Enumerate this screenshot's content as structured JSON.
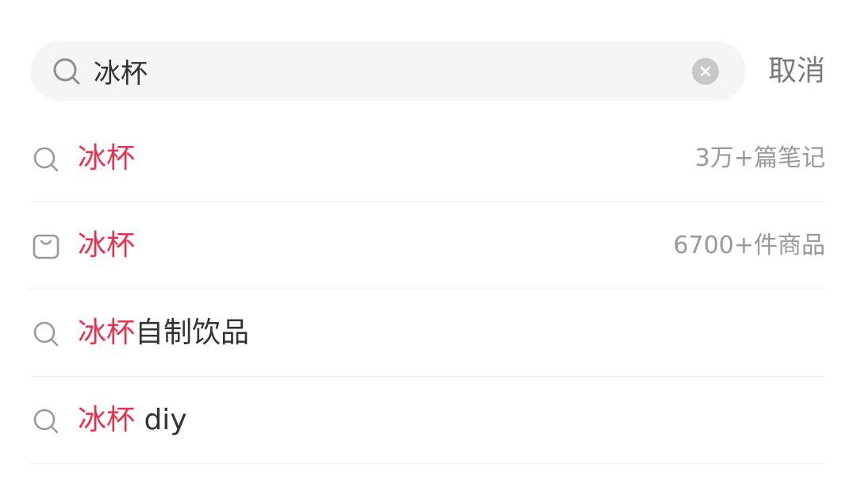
{
  "colors": {
    "highlight": "#e8304f",
    "primary_text": "#333333",
    "secondary_text": "#999999",
    "search_bg": "#f5f5f5"
  },
  "search": {
    "query": "冰杯",
    "icon": "search-icon",
    "clear_icon": "clear-icon",
    "cancel_label": "取消"
  },
  "suggestions": [
    {
      "icon": "search-icon",
      "highlight": "冰杯",
      "rest": "",
      "meta": "3万+篇笔记"
    },
    {
      "icon": "shopping-bag-icon",
      "highlight": "冰杯",
      "rest": "",
      "meta": "6700+件商品"
    },
    {
      "icon": "search-icon",
      "highlight": "冰杯",
      "rest": "自制饮品",
      "meta": ""
    },
    {
      "icon": "search-icon",
      "highlight": "冰杯",
      "rest": " diy",
      "meta": ""
    }
  ]
}
